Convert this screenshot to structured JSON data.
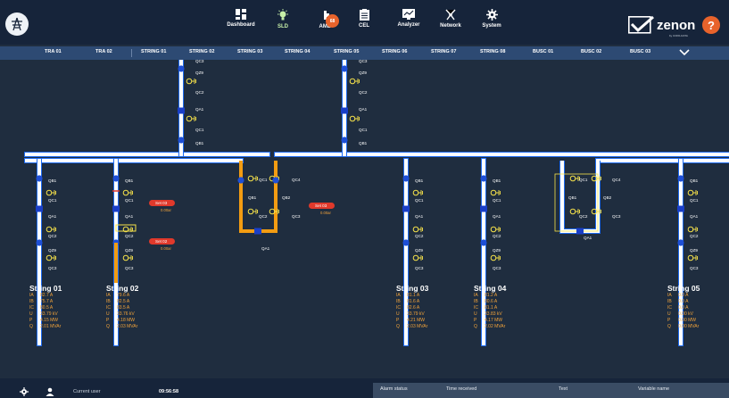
{
  "topbar": {
    "nav": [
      {
        "label": "Dashboard",
        "icon": "dashboard-icon"
      },
      {
        "label": "SLD",
        "icon": "sld-lightbulb-icon"
      },
      {
        "label": "AML",
        "icon": "aml-alarm-icon",
        "badge": "68"
      },
      {
        "label": "CEL",
        "icon": "cel-list-icon"
      },
      {
        "label": "Analyzer",
        "icon": "analyzer-icon"
      },
      {
        "label": "Network",
        "icon": "network-icon"
      },
      {
        "label": "System",
        "icon": "system-gear-icon"
      }
    ],
    "brand": {
      "name": "zenon",
      "sub": "by COPA-DATA"
    },
    "help": "?"
  },
  "tabs": [
    "TRA 01",
    "TRA 02",
    "STRING 01",
    "STRING 02",
    "STRING 03",
    "STRING 04",
    "STRING 05",
    "STRING 06",
    "STRING 07",
    "STRING 08",
    "BUSC 01",
    "BUSC 02",
    "BUSC 03"
  ],
  "diagram": {
    "top_feeders": [
      {
        "labels": [
          "QC3",
          "QZ9",
          "QC2",
          "QA1",
          "QC1",
          "QB1"
        ]
      },
      {
        "labels": [
          "QC3",
          "QZ9",
          "QC2",
          "QA1",
          "QC1",
          "QB1"
        ]
      }
    ],
    "strings": [
      {
        "title": "String 01",
        "labels": [
          "QB1",
          "QC1",
          "QA1",
          "QC2",
          "QZ9",
          "QC3"
        ],
        "IA": "82.7 A",
        "IB": "75.7 A",
        "IC": "80.5 A",
        "U": "33.79 kV",
        "P": "4.15 MW",
        "Q": "2.01 MVAr"
      },
      {
        "title": "String 02",
        "labels": [
          "QB1",
          "QC1",
          "QA1",
          "QC2",
          "QZ9",
          "QC3"
        ],
        "IA": "79.6 A",
        "IB": "82.5 A",
        "IC": "83.5 A",
        "U": "33.76 kV",
        "P": "4.18 MW",
        "Q": "2.03 MVAr"
      },
      {
        "title": "String 03",
        "labels": [
          "QB1",
          "QC1",
          "QA1",
          "QC2",
          "QZ9",
          "QC3"
        ],
        "IA": "81.1 A",
        "IB": "81.6 A",
        "IC": "82.6 A",
        "U": "33.79 kV",
        "P": "4.21 MW",
        "Q": "2.03 MVAr"
      },
      {
        "title": "String 04",
        "labels": [
          "QB1",
          "QC1",
          "QA1",
          "QC2",
          "QZ9",
          "QC3"
        ],
        "IA": "81.2 A",
        "IB": "80.6 A",
        "IC": "81.1 A",
        "U": "33.83 kV",
        "P": "4.17 MW",
        "Q": "2.02 MVAr"
      },
      {
        "title": "String 05",
        "labels": [
          "QB1",
          "QC1",
          "QA1",
          "QC2",
          "QZ9",
          "QC3"
        ],
        "IA": "0.0 A",
        "IB": "0.0 A",
        "IC": "0.0 A",
        "U": "0.00 kV",
        "P": "0.00 MW",
        "Q": "0.00 MVAr"
      }
    ],
    "measure_keys": [
      "IA",
      "IB",
      "IC",
      "U",
      "P",
      "Q"
    ],
    "coupler_1_labels": [
      "QC1",
      "QC4",
      "QB1",
      "QB2",
      "QC2",
      "QC3",
      "QA1"
    ],
    "coupler_2_labels": [
      "QC1",
      "QC4",
      "QB1",
      "QB2",
      "QC2",
      "QC3",
      "QA1"
    ],
    "alarm_tags": [
      {
        "title": "Set 03",
        "sub": "0.00ar"
      },
      {
        "title": "Set 02",
        "sub": "0.00ar"
      },
      {
        "title": "Set 03",
        "sub": "0.00ar"
      }
    ],
    "colors": {
      "bus": "#ffffff",
      "bus_edge": "#1e6bf0",
      "node": "#1e4fd6",
      "breaker": "#1a3fc8",
      "energized": "#f39c12",
      "earth": "#f7e34a",
      "alarm": "#e0392b",
      "measure": "#f2a33a"
    }
  },
  "footer": {
    "current_user_label": "Current user",
    "time": "09:56:58",
    "alarm_columns": [
      "Alarm status",
      "Time received",
      "Text",
      "Variable name"
    ]
  }
}
